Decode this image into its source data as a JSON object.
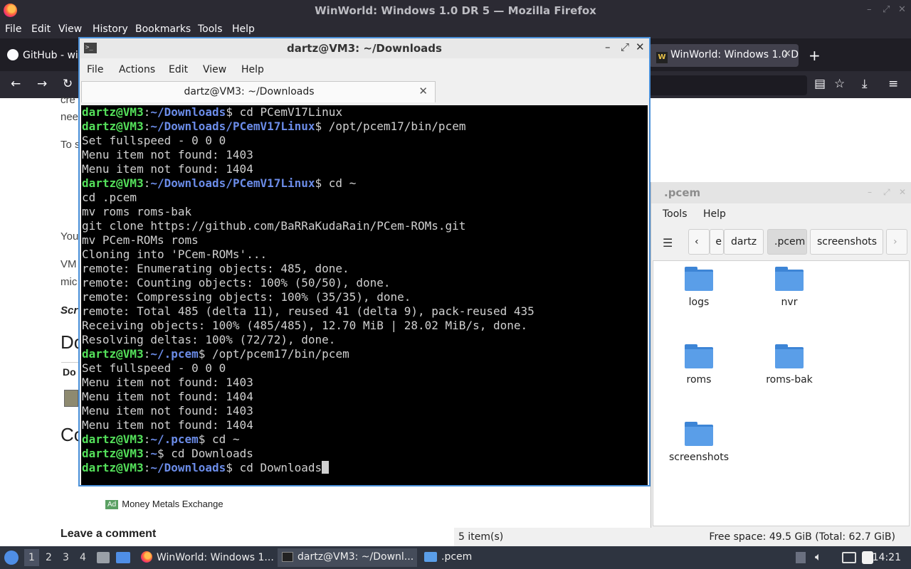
{
  "firefox": {
    "title": "WinWorld: Windows 1.0 DR 5 — Mozilla Firefox",
    "menu": [
      "File",
      "Edit",
      "View",
      "History",
      "Bookmarks",
      "Tools",
      "Help"
    ],
    "tabs": [
      {
        "label": "GitHub - win"
      },
      {
        "label": "WinWorld: Windows 1.0 D"
      }
    ],
    "page": {
      "frag_cre": "cre",
      "frag_nee": "nee",
      "frag_to": "To s",
      "frag_you": "You",
      "frag_vm": "VM",
      "frag_mic": "mic",
      "frag_scr": "Scr",
      "frag_do": "Do",
      "frag_dot": "Do",
      "frag_co": "Co",
      "ad_badge": "Ad",
      "ad_text": "Money Metals Exchange",
      "leave_comment": "Leave a comment"
    }
  },
  "terminal": {
    "title": "dartz@VM3: ~/Downloads",
    "menu": [
      "File",
      "Actions",
      "Edit",
      "View",
      "Help"
    ],
    "tab_label": "dartz@VM3: ~/Downloads",
    "lines": [
      {
        "user": "dartz@VM3",
        "path": "~/Downloads",
        "cmd": "$ cd PCemV17Linux"
      },
      {
        "user": "dartz@VM3",
        "path": "~/Downloads/PCemV17Linux",
        "cmd": "$ /opt/pcem17/bin/pcem"
      },
      {
        "text": "Set fullspeed - 0 0 0"
      },
      {
        "text": "Menu item not found: 1403"
      },
      {
        "text": "Menu item not found: 1404"
      },
      {
        "user": "dartz@VM3",
        "path": "~/Downloads/PCemV17Linux",
        "cmd": "$ cd ~"
      },
      {
        "text": "cd .pcem"
      },
      {
        "text": "mv roms roms-bak"
      },
      {
        "text": "git clone https://github.com/BaRRaKudaRain/PCem-ROMs.git"
      },
      {
        "text": "mv PCem-ROMs roms"
      },
      {
        "text": "Cloning into 'PCem-ROMs'..."
      },
      {
        "text": "remote: Enumerating objects: 485, done."
      },
      {
        "text": "remote: Counting objects: 100% (50/50), done."
      },
      {
        "text": "remote: Compressing objects: 100% (35/35), done."
      },
      {
        "text": "remote: Total 485 (delta 11), reused 41 (delta 9), pack-reused 435"
      },
      {
        "text": "Receiving objects: 100% (485/485), 12.70 MiB | 28.02 MiB/s, done."
      },
      {
        "text": "Resolving deltas: 100% (72/72), done."
      },
      {
        "user": "dartz@VM3",
        "path": "~/.pcem",
        "cmd": "$ /opt/pcem17/bin/pcem"
      },
      {
        "text": "Set fullspeed - 0 0 0"
      },
      {
        "text": "Menu item not found: 1403"
      },
      {
        "text": "Menu item not found: 1404"
      },
      {
        "text": "Menu item not found: 1403"
      },
      {
        "text": "Menu item not found: 1404"
      },
      {
        "user": "dartz@VM3",
        "path": "~/.pcem",
        "cmd": "$ cd ~"
      },
      {
        "user": "dartz@VM3",
        "path": "~",
        "cmd": "$ cd Downloads"
      },
      {
        "user": "dartz@VM3",
        "path": "~/Downloads",
        "cmd": "$ cd Downloads",
        "cursor": true
      }
    ]
  },
  "filemanager": {
    "title": ".pcem",
    "menu": [
      "Tools",
      "Help"
    ],
    "path": [
      "e",
      "dartz",
      ".pcem",
      "screenshots"
    ],
    "items": [
      "logs",
      "nvr",
      "roms",
      "roms-bak",
      "screenshots"
    ],
    "status_count": "5 item(s)",
    "status_space": "Free space: 49.5 GiB (Total: 62.7 GiB)"
  },
  "taskbar": {
    "workspaces": [
      "1",
      "2",
      "3",
      "4"
    ],
    "tasks": [
      "WinWorld: Windows 1...",
      "dartz@VM3: ~/Downl...",
      ".pcem"
    ],
    "clock": "14:21"
  },
  "colors": {
    "prompt_user": "#54e05a",
    "prompt_path": "#6b8ce8",
    "folder": "#5a9ee8",
    "accent_border": "#4a90d9"
  }
}
